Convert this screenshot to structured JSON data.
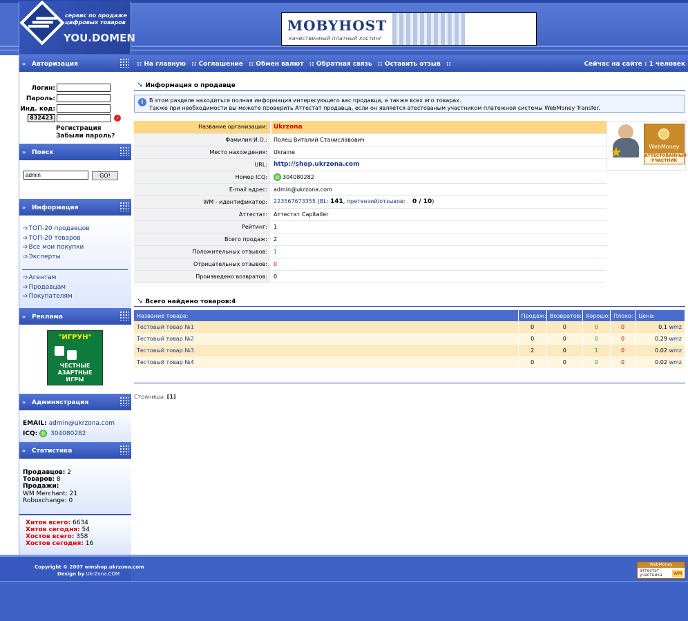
{
  "header": {
    "logo_tagline_1": "сервис по продаже",
    "logo_tagline_2": "цифровых товаров",
    "logo_brand": "YOU.DOMEN",
    "banner_name": "MOBYHOST",
    "banner_sub": "качественный платный хостинг"
  },
  "nav": {
    "links": [
      ":: На главную",
      ":: Соглашение",
      ":: Обмен валют",
      ":: Обратная связь",
      ":: Оставить отзыв",
      "::"
    ],
    "online": "Сейчас на сайте : 1 человек"
  },
  "sidebar": {
    "auth": {
      "title": "Авторизация",
      "login_label": "Логин:",
      "password_label": "Пароль:",
      "code_label": "Инд. код:",
      "captcha": "832423",
      "register": "Регистрация",
      "forgot": "Забыли пароль?"
    },
    "search": {
      "title": "Поиск",
      "value": "admin",
      "button": "GO!"
    },
    "info": {
      "title": "Информация",
      "items": [
        "ТОП-20 продавцов",
        "ТОП-20 товаров",
        "Все мои покупки",
        "Эксперты"
      ],
      "items2": [
        "Агентам",
        "Продавцам",
        "Покупателям"
      ]
    },
    "ad": {
      "title": "Реклама",
      "name": "\"ИГРУН\"",
      "text1": "ЧЕСТНЫЕ",
      "text2": "АЗАРТНЫЕ",
      "text3": "ИГРЫ"
    },
    "admin": {
      "title": "Администрация",
      "email_label": "EMAIL:",
      "email": "admin@ukrzona.com",
      "icq_label": "ICQ:",
      "icq": "304080282"
    },
    "stats": {
      "title": "Статистика",
      "sellers_label": "Продавцов:",
      "sellers": "2",
      "goods_label": "Товаров:",
      "goods": "8",
      "sales_label": "Продажи:",
      "wm_merchant": "WM Merchant: 21",
      "roboxchange": "Roboxchange: 0",
      "hits_total_label": "Хитов всего:",
      "hits_total": "6634",
      "hits_today_label": "Хитов сегодня:",
      "hits_today": "54",
      "hosts_total_label": "Хостов всего:",
      "hosts_total": "358",
      "hosts_today_label": "Хостов сегодня:",
      "hosts_today": "16"
    }
  },
  "main": {
    "title": "Информация о продавце",
    "notice_1": "В этом разделе находиться полная информация интересующего вас продавца, а также всех его товарах.",
    "notice_2": "Также при необходимости вы можете проверить Аттестат продавца, если он является атестованым участником платежной системы WebMoney Transfer.",
    "seller": [
      {
        "k": "Название организации:",
        "v": "Ukrzona"
      },
      {
        "k": "Фамилия И.О.:",
        "v": "Полец Виталий Станиславович"
      },
      {
        "k": "Место нахождения:",
        "v": "Ukraine"
      },
      {
        "k": "URL:",
        "v": "http://shop.ukrzona.com"
      },
      {
        "k": "Номер ICQ:",
        "v": "304080282"
      },
      {
        "k": "E-mail адрес:",
        "v": "admin@ukrzona.com"
      },
      {
        "k": "WM - идентификатор:",
        "v": ""
      },
      {
        "k": "Аттестат:",
        "v": "Аттестат Capitaller"
      },
      {
        "k": "Рейтинг:",
        "v": "1"
      },
      {
        "k": "Всего продаж:",
        "v": "2"
      },
      {
        "k": "Положительных отзывов:",
        "v": "1"
      },
      {
        "k": "Отрицательных отзывов:",
        "v": "0"
      },
      {
        "k": "Произведено возвратов:",
        "v": "0"
      }
    ],
    "wm": {
      "id": "223567673355",
      "bl_label": "BL:",
      "bl": "141",
      "claims": "претензий",
      "reviews": "отзывов",
      "ratio": "0 / 10"
    },
    "wm_badge_title": "WebMoney",
    "wm_badge_sub": "АТТЕСТОВАННЫЙ УЧАСТНИК",
    "goods_title": "Всего найдено товаров:4",
    "goods_headers": [
      "Название товара:",
      "Продаж:",
      "Возвратов:",
      "Хорошо:",
      "Плохо:",
      "Цена:"
    ],
    "goods": [
      {
        "name": "Тестовый товар №1",
        "sales": "0",
        "returns": "0",
        "good": "0",
        "bad": "0",
        "price": "0.1",
        "cur": "wmz"
      },
      {
        "name": "Тестовый товар №2",
        "sales": "0",
        "returns": "0",
        "good": "0",
        "bad": "0",
        "price": "0.29",
        "cur": "wmz"
      },
      {
        "name": "Тестовый товар №3",
        "sales": "2",
        "returns": "0",
        "good": "1",
        "bad": "0",
        "price": "0.02",
        "cur": "wmz"
      },
      {
        "name": "Тестовый товар №4",
        "sales": "0",
        "returns": "0",
        "good": "0",
        "bad": "0",
        "price": "0.02",
        "cur": "wmz"
      }
    ],
    "pages_label": "Страницы:",
    "pages": "[1]"
  },
  "footer": {
    "copyright": "Copyright © 2007 wmshop.ukrzona.com",
    "design_label": "Design by",
    "design": "UkrZona.COM",
    "wm_top": "WebMoney",
    "wm_line1": "аттестат",
    "wm_line2": "участника",
    "wm_logo": "WM"
  },
  "colors": {
    "accent": "#4a6ccc",
    "highlight": "#ffd782",
    "error": "#dd0000",
    "positive": "#1a9a1a"
  }
}
